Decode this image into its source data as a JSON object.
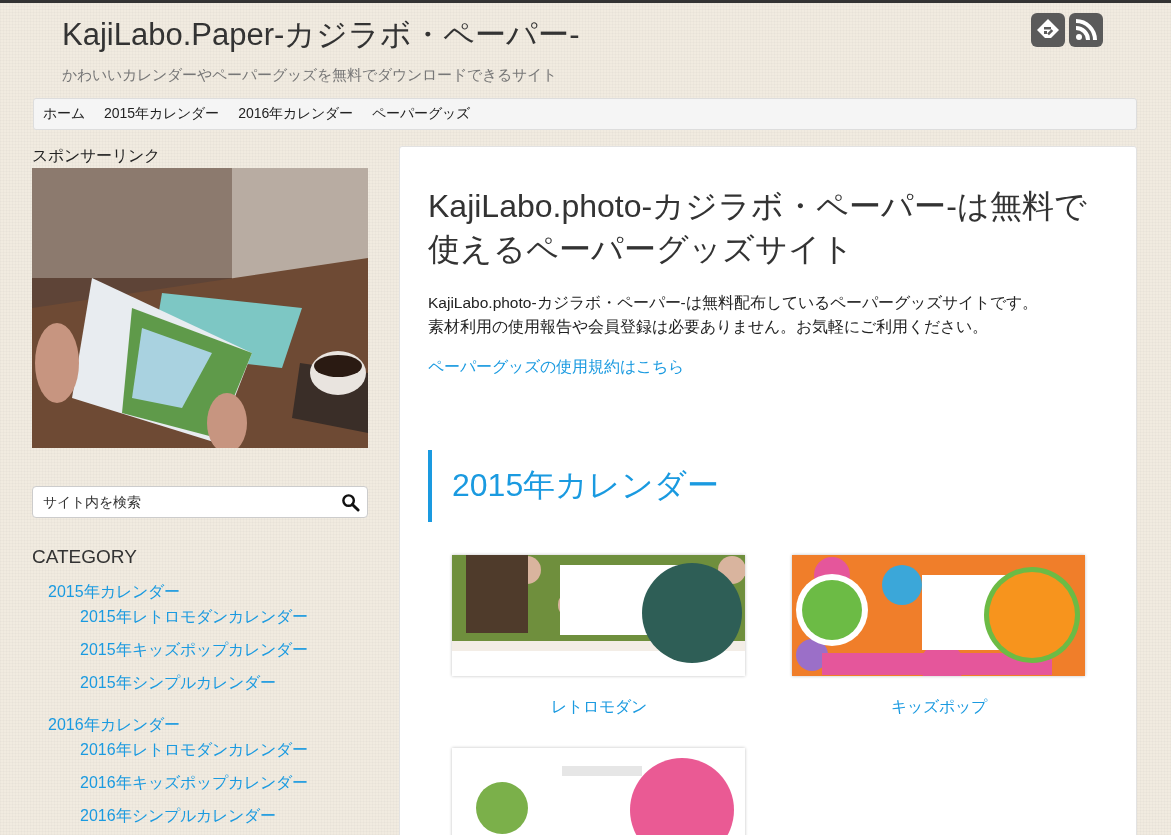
{
  "site": {
    "title": "KajiLabo.Paper-カジラボ・ペーパー-",
    "tagline": "かわいいカレンダーやペーパーグッズを無料でダウンロードできるサイト"
  },
  "nav": [
    {
      "label": "ホーム"
    },
    {
      "label": "2015年カレンダー"
    },
    {
      "label": "2016年カレンダー"
    },
    {
      "label": "ペーパーグッズ"
    }
  ],
  "sidebar": {
    "sponsor_heading": "スポンサーリンク",
    "search": {
      "placeholder": "サイト内を検索"
    },
    "category_heading": "CATEGORY",
    "categories": [
      {
        "label": "2015年カレンダー",
        "children": [
          {
            "label": "2015年レトロモダンカレンダー"
          },
          {
            "label": "2015年キッズポップカレンダー"
          },
          {
            "label": "2015年シンプルカレンダー"
          }
        ]
      },
      {
        "label": "2016年カレンダー",
        "children": [
          {
            "label": "2016年レトロモダンカレンダー"
          },
          {
            "label": "2016年キッズポップカレンダー"
          },
          {
            "label": "2016年シンプルカレンダー"
          }
        ]
      }
    ]
  },
  "main": {
    "heading": "KajiLabo.photo-カジラボ・ペーパー-は無料で使えるペーパーグッズサイト",
    "paragraph": [
      "KajiLabo.photo-カジラボ・ペーパー-は無料配布しているペーパーグッズサイトです。",
      "素材利用の使用報告や会員登録は必要ありません。お気軽にご利用ください。"
    ],
    "terms_link": "ペーパーグッズの使用規約はこちら",
    "section_heading": "2015年カレンダー",
    "items": [
      {
        "kind": "retro",
        "caption": "レトロモダン"
      },
      {
        "kind": "kids",
        "caption": "キッズポップ"
      },
      {
        "kind": "simple"
      }
    ]
  }
}
